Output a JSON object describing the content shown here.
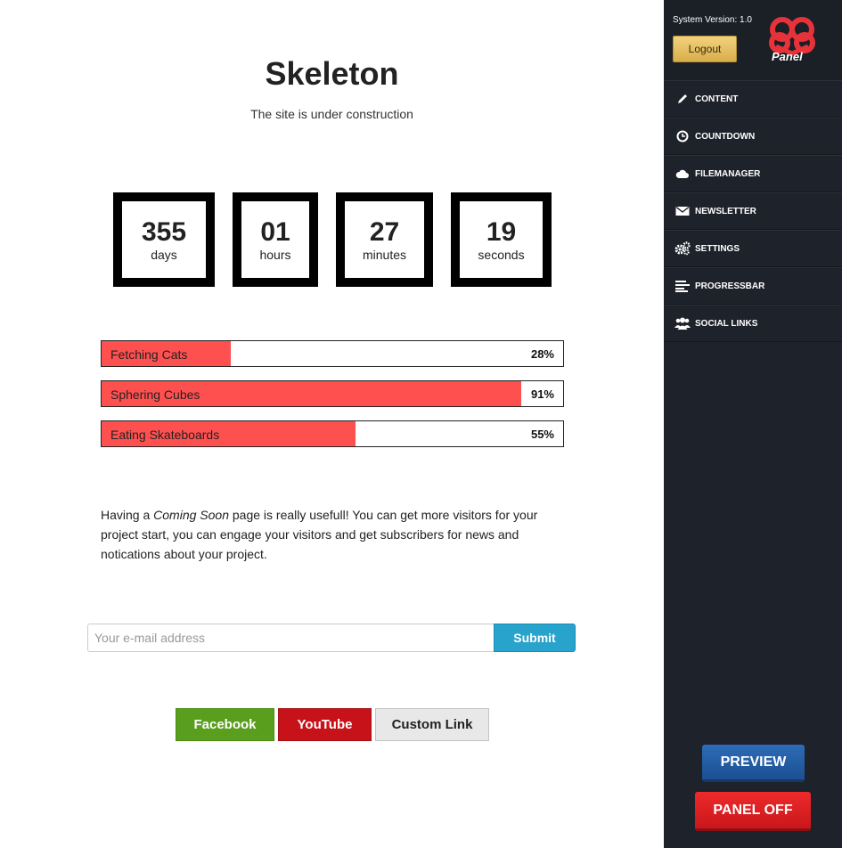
{
  "page": {
    "title": "Skeleton",
    "subtitle": "The site is under construction"
  },
  "countdown": [
    {
      "value": "355",
      "label": "days"
    },
    {
      "value": "01",
      "label": "hours"
    },
    {
      "value": "27",
      "label": "minutes"
    },
    {
      "value": "19",
      "label": "seconds"
    }
  ],
  "progress": [
    {
      "label": "Fetching Cats",
      "value_text": "28%",
      "fraction": 0.28
    },
    {
      "label": "Sphering Cubes",
      "value_text": "91%",
      "fraction": 0.91
    },
    {
      "label": "Eating Skateboards",
      "value_text": "55%",
      "fraction": 0.55
    }
  ],
  "description": {
    "before": "Having a ",
    "emphasis": "Coming Soon",
    "after": " page is really usefull! You can get more visitors for your project start, you can engage your visitors and get subscribers for news and notications about your project."
  },
  "newsletter": {
    "placeholder": "Your e-mail address",
    "submit_label": "Submit"
  },
  "social": {
    "facebook": "Facebook",
    "youtube": "YouTube",
    "custom": "Custom Link"
  },
  "panel": {
    "system_version": "System Version: 1.0",
    "logout_label": "Logout",
    "logo_text": "Panel",
    "menu": [
      {
        "label": "CONTENT",
        "icon": "pencil-icon"
      },
      {
        "label": "COUNTDOWN",
        "icon": "clock-icon"
      },
      {
        "label": "FILEMANAGER",
        "icon": "cloud-icon"
      },
      {
        "label": "NEWSLETTER",
        "icon": "envelope-icon"
      },
      {
        "label": "SETTINGS",
        "icon": "gears-icon"
      },
      {
        "label": "PROGRESSBAR",
        "icon": "bars-icon"
      },
      {
        "label": "SOCIAL LINKS",
        "icon": "users-icon"
      }
    ],
    "preview_label": "PREVIEW",
    "panel_off_label": "PANEL OFF"
  },
  "colors": {
    "progress_fill": "#ff5050",
    "panel_bg": "#1e222a",
    "submit": "#27a3cc",
    "facebook": "#5a9e1d",
    "youtube": "#c8121a",
    "preview": "#1c4f91",
    "panel_off": "#c9171c",
    "logo": "#e8323a"
  }
}
